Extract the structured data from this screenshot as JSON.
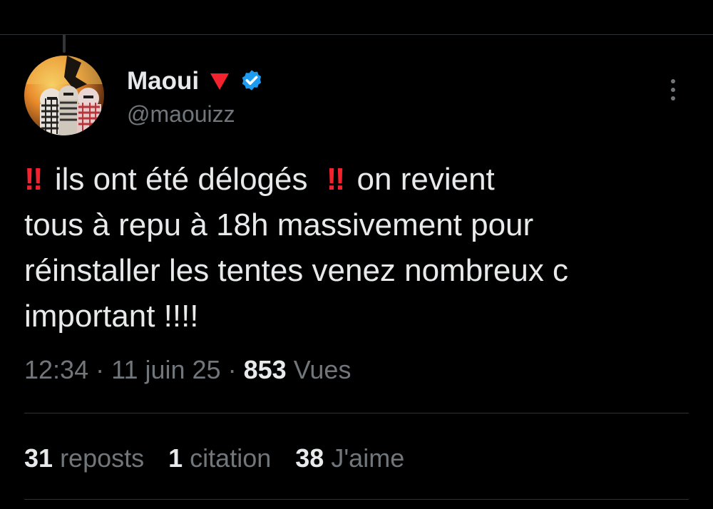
{
  "author": {
    "display_name": "Maoui",
    "name_emoji": "red-triangle-down-icon",
    "verified_icon": "verified-badge-icon",
    "handle": "@maouizz"
  },
  "tweet": {
    "bang": "‼",
    "line1_a": "ils ont été délogés",
    "line1_b": "on revient",
    "line2": "tous à repu à 18h massivement pour",
    "line3": "réinstaller les tentes venez nombreux c",
    "line4": "important !!!!"
  },
  "meta": {
    "time": "12:34",
    "separator": "·",
    "date": "11 juin 25",
    "views_count": "853",
    "views_label": "Vues"
  },
  "stats": {
    "reposts_count": "31",
    "reposts_label": "reposts",
    "quotes_count": "1",
    "quotes_label": "citation",
    "likes_count": "38",
    "likes_label": "J'aime"
  },
  "colors": {
    "background": "#000000",
    "text": "#e7e9ea",
    "secondary_text": "#71767b",
    "accent_red": "#f4212e",
    "verified_blue": "#1d9bf0"
  }
}
